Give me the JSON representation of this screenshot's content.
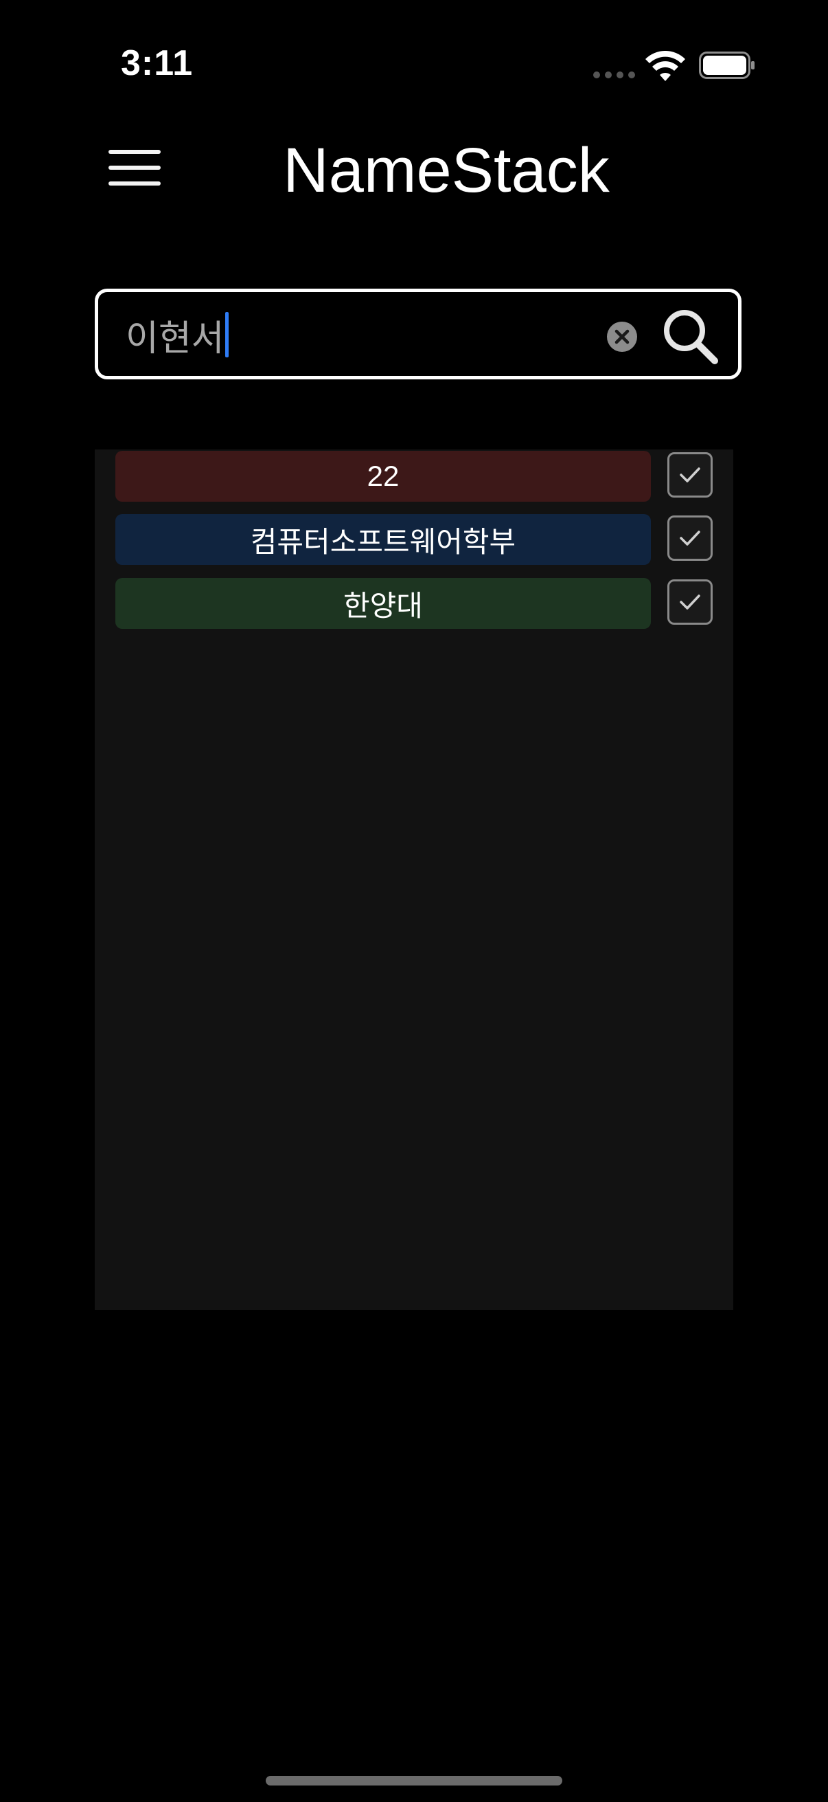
{
  "status_bar": {
    "time": "3:11"
  },
  "header": {
    "title": "NameStack"
  },
  "search": {
    "value": "이현서"
  },
  "tags": [
    {
      "label": "22",
      "color": "#3d1818",
      "checked": true
    },
    {
      "label": "컴퓨터소프트웨어학부",
      "color": "#10243f",
      "checked": true
    },
    {
      "label": "한양대",
      "color": "#1d3521",
      "checked": true
    }
  ],
  "icons": {
    "menu": "hamburger-icon",
    "clear": "clear-circle-icon",
    "search": "magnifier-icon",
    "check": "checkmark-icon"
  }
}
